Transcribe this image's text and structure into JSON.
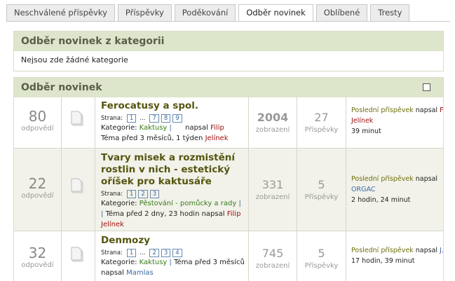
{
  "tabs": [
    "Neschválené příspěvky",
    "Příspěvky",
    "Poděkování",
    "Odběr novinek",
    "Oblíbené",
    "Tresty"
  ],
  "category_panel": {
    "title": "Odběr novinek z kategorii",
    "empty_text": "Nejsou zde žádné kategorie"
  },
  "news_panel": {
    "title": "Odběr novinek"
  },
  "labels": {
    "replies": "odpovědí",
    "views": "zobrazení",
    "posts": "Příspěvky",
    "pages": "Strana:",
    "category": "Kategorie:",
    "last_post": "Poslední příspěvek",
    "wrote": "napsal",
    "ellipsis": "..."
  },
  "topics": [
    {
      "replies": "80",
      "title": "Ferocatusy a spol.",
      "pages_first": [
        "1"
      ],
      "pages_last": [
        "7",
        "8",
        "9"
      ],
      "category": "Kaktusy",
      "sep": "|",
      "after_cat": "",
      "author_inline": "napsal",
      "author_inline_name": "Filip",
      "line3": "Téma před 3 měsíců, 1 týden",
      "line3_author": "Jelínek",
      "views": "2004",
      "posts": "27",
      "last_user": "F",
      "last_user2": "Jelínek",
      "last_time": "39 minut"
    },
    {
      "replies": "22",
      "title": "Tvary misek a rozmistění rostlin v nich - estetický oříšek pro kaktusáře",
      "pages": [
        "1",
        "2",
        "3"
      ],
      "category": "Pěstování - pomůcky a rady",
      "sep": "|",
      "line3": "Téma před 2 dny, 23 hodin napsal",
      "line3_author": "Filip",
      "line4_author": "Jelínek",
      "views": "331",
      "posts": "5",
      "last_user": "ORGAC",
      "last_time": "2 hodin, 24 minut"
    },
    {
      "replies": "32",
      "title": "Denmozy",
      "pages_first": [
        "1"
      ],
      "pages_last": [
        "2",
        "3",
        "4"
      ],
      "category": "Kaktusy",
      "sep": "|",
      "line_cat_tail": "Téma před 3 měsíců",
      "line3": "napsal",
      "line3_author": "Mamlas",
      "views": "745",
      "posts": "5",
      "last_user": "J.",
      "last_time": "17 hodin, 39 minut"
    }
  ],
  "colors": {
    "header_bg": "#dde5cb",
    "header_text": "#5a6048",
    "title": "#555510",
    "category": "#3a7a1a",
    "user_red": "#a01010",
    "user_blue": "#3a68a0"
  }
}
